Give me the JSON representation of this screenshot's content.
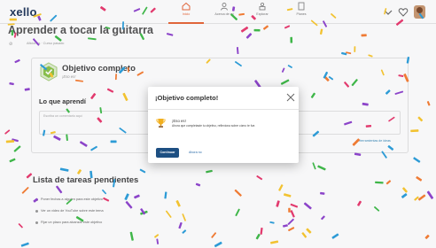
{
  "header": {
    "logo": "xello",
    "nav": [
      {
        "label": "Inicio",
        "icon": "home-icon"
      },
      {
        "label": "Acerca de mí",
        "icon": "person-icon"
      },
      {
        "label": "Explorar",
        "icon": "explore-icon"
      },
      {
        "label": "Planes",
        "icon": "plans-icon"
      }
    ],
    "right_icons": [
      "notifications-icon",
      "heart-icon",
      "avatar"
    ]
  },
  "page": {
    "title": "Aprender a tocar la guitarra",
    "meta": "Aficiones · Curso pasado"
  },
  "goal": {
    "title": "Objetivo completo",
    "subtitle": "¡Eso es!",
    "learned_title": "Lo que aprendí",
    "learned_placeholder": "Escriba un comentario aquí",
    "resources_link": "Herramientas de ideas"
  },
  "todo": {
    "title": "Lista de tareas pendientes",
    "items": [
      "Poner fechas a alguien para este objetivo",
      "Ver un video de YouTube sobre este tema",
      "Fijar un plazo para alcanzar este objetivo"
    ]
  },
  "modal": {
    "title": "¡Objetivo completo!",
    "subtitle": "¡Eso es!",
    "body": "Ahora que completaste tu objetivo, reflexiona sobre cómo te fue.",
    "primary_button": "Continuar",
    "secondary_link": "Ahora no"
  },
  "colors": {
    "brand_navy": "#23395d",
    "accent_orange": "#e8683a",
    "button_blue": "#1d4f82",
    "goal_green": "#8bc34a",
    "confetti": [
      "#e23a6e",
      "#2d9bd6",
      "#f2c230",
      "#8c44c9",
      "#3fb649",
      "#ef7b34"
    ]
  }
}
